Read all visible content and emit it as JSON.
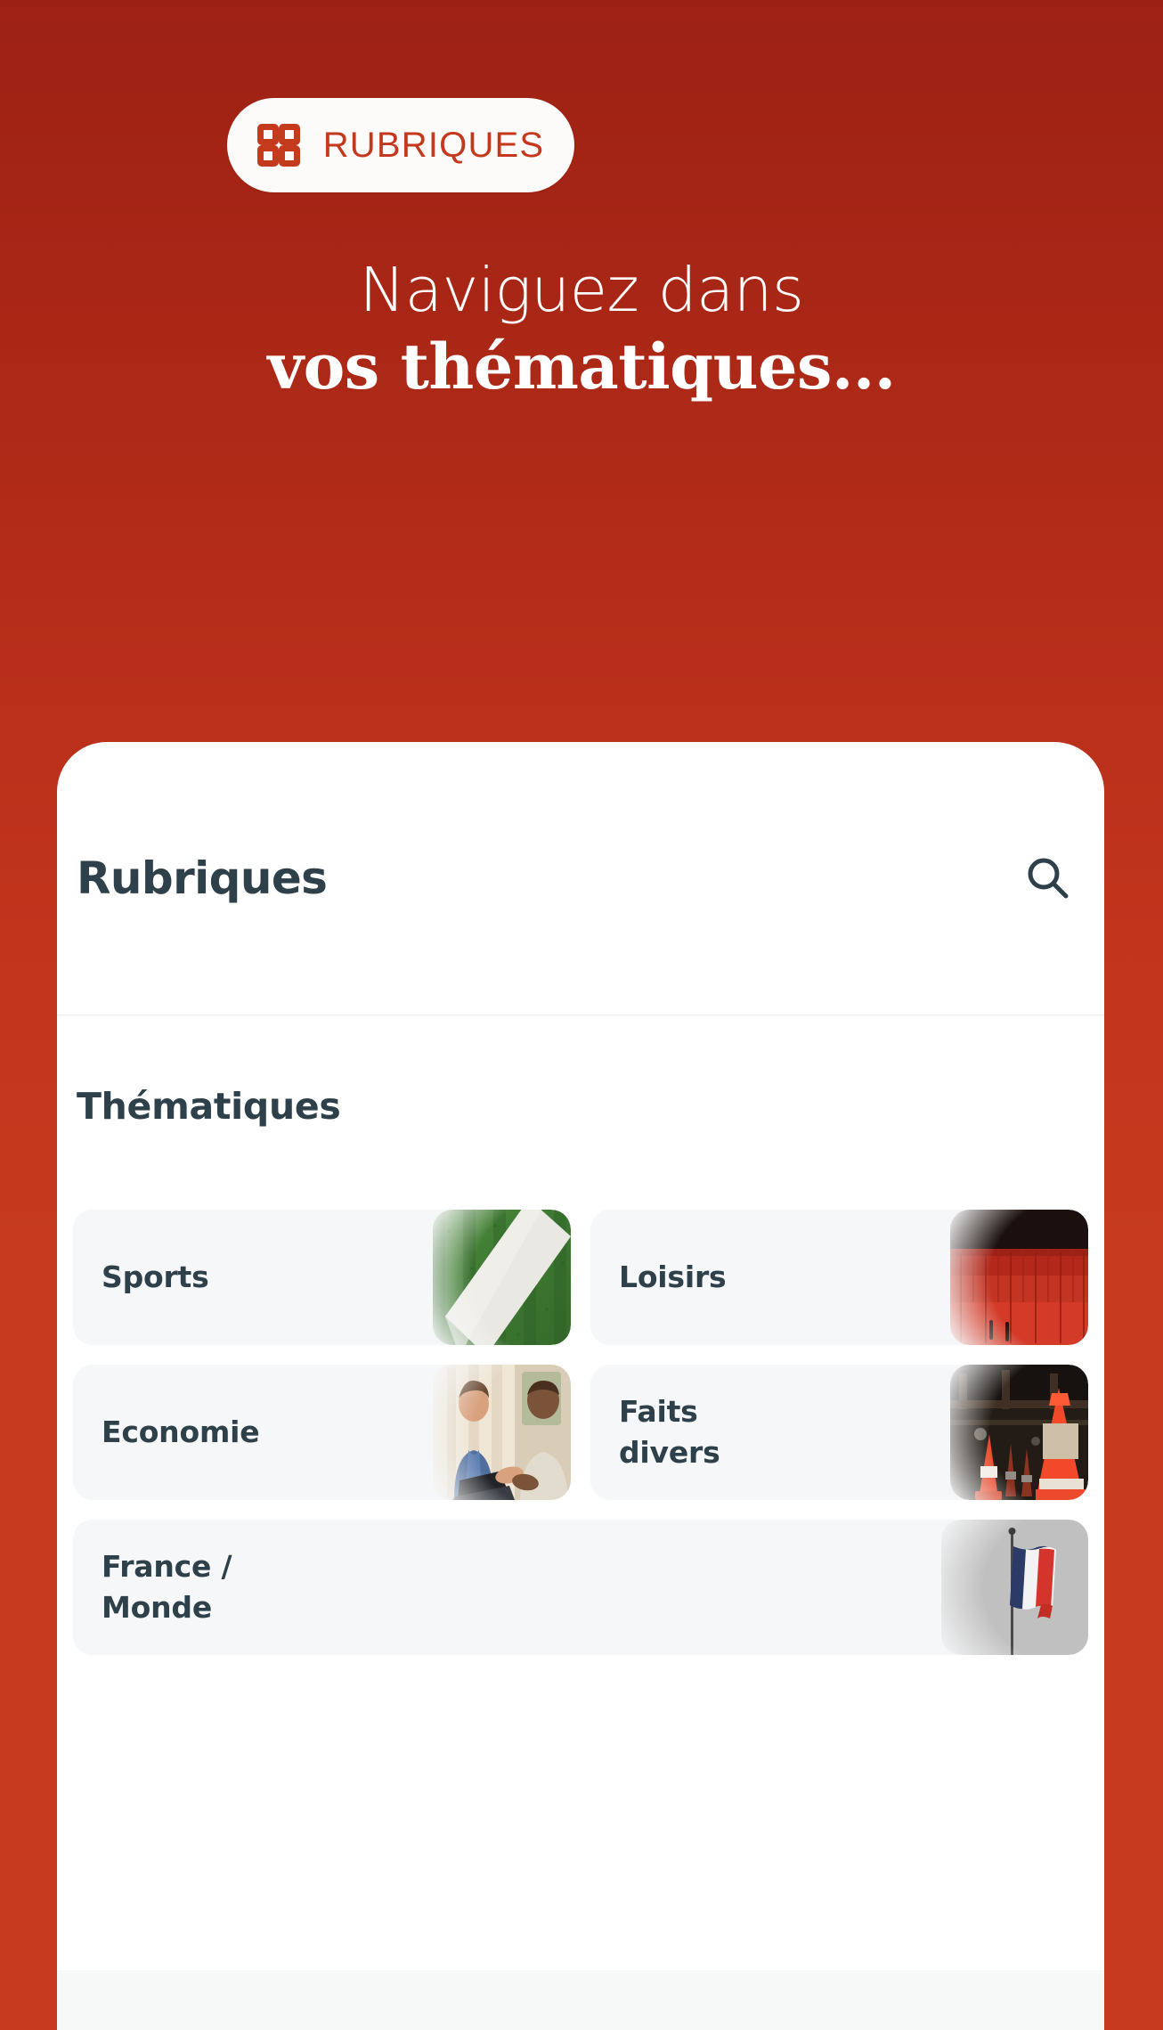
{
  "theme": {
    "brand_red": "#C4391D",
    "backdrop_top": "#9D2113",
    "backdrop_bottom": "#C6391D",
    "text_dark": "#2E4049",
    "card_bg": "#F6F7F8",
    "sheet_bg": "#FFFFFF"
  },
  "pill": {
    "label": "RUBRIQUES",
    "icon": "grid-icon"
  },
  "hero": {
    "line1": "Naviguez dans",
    "line2": "vos thématiques..."
  },
  "sheet": {
    "title": "Rubriques",
    "search_icon": "search-icon",
    "section_label": "Thématiques",
    "themes": [
      {
        "label": "Sports",
        "image": "sports-field-thumbnail"
      },
      {
        "label": "Loisirs",
        "image": "cinema-seats-thumbnail"
      },
      {
        "label": "Economie",
        "image": "business-meeting-thumbnail"
      },
      {
        "label": "Faits\ndivers",
        "image": "traffic-cones-thumbnail"
      },
      {
        "label": "France /\nMonde",
        "image": "french-flag-thumbnail"
      }
    ]
  }
}
